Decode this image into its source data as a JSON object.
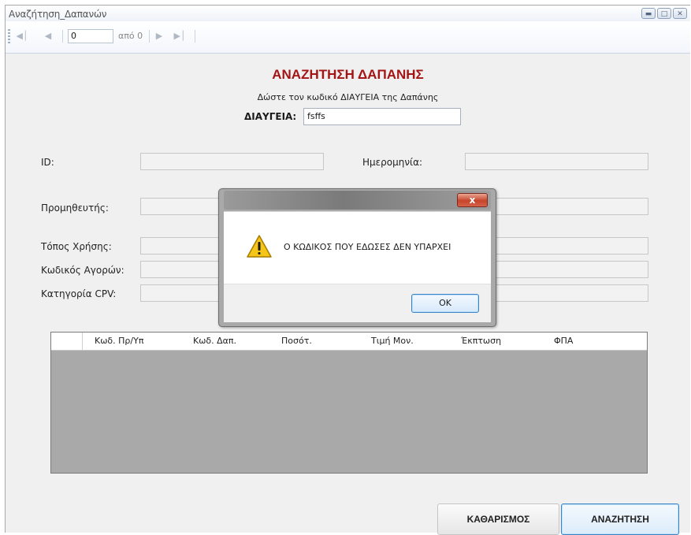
{
  "window": {
    "title": "Αναζήτηση_Δαπανών",
    "controls": [
      "minimize-icon",
      "maximize-icon",
      "close-icon"
    ]
  },
  "navigator": {
    "position_value": "0",
    "of_label": "από 0"
  },
  "form": {
    "title": "ΑΝΑΖΗΤΗΣΗ ΔΑΠΑΝΗΣ",
    "subtitle": "Δώστε τον κωδικό ΔΙΑΥΓΕΙΑ της Δαπάνης",
    "diaugeia_label": "ΔΙΑΥΓΕΙΑ:",
    "diaugeia_value": "fsffs",
    "labels": {
      "id": "ID:",
      "date": "Ημερομηνία:",
      "supplier": "Προμηθευτής:",
      "place_of_use": "Τόπος Χρήσης:",
      "purchase_code": "Κωδικός Αγορών:",
      "cpv_category": "Κατηγορία CPV:"
    }
  },
  "grid": {
    "columns": [
      "Κωδ. Πρ/Υπ",
      "Κωδ. Δαπ.",
      "Ποσότ.",
      "Τιμή Μον.",
      "Έκπτωση",
      "ΦΠΑ"
    ]
  },
  "buttons": {
    "clear": "ΚΑΘΑΡΙΣΜΟΣ",
    "search": "ΑΝΑΖΗΤΗΣΗ"
  },
  "dialog": {
    "message": "Ο ΚΩΔΙΚΟΣ ΠΟΥ ΕΔΩΣΕΣ ΔΕΝ ΥΠΑΡΧΕΙ",
    "ok_label": "OK",
    "close_glyph": "x",
    "icon": "warning-icon"
  },
  "colors": {
    "title_red": "#a51414",
    "accent_blue": "#3a83c5"
  }
}
